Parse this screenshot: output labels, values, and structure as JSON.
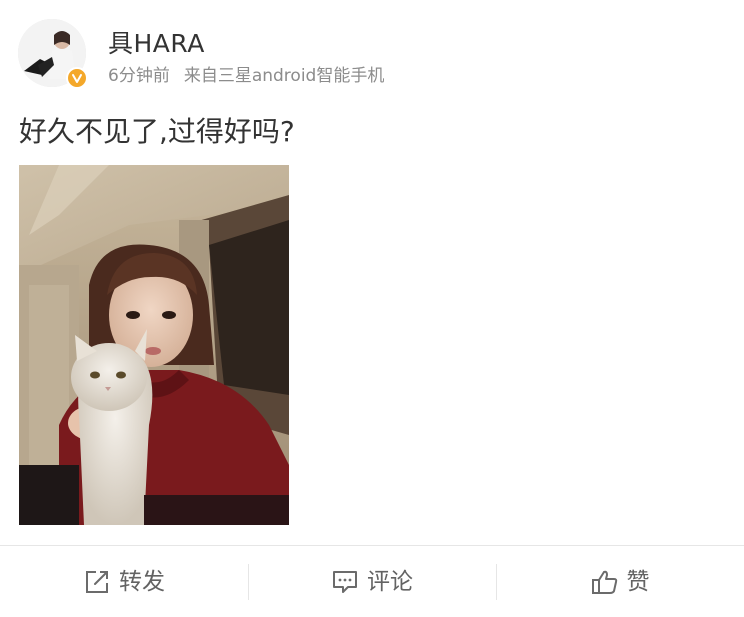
{
  "post": {
    "username": "具HARA",
    "time": "6分钟前",
    "source": "来自三星android智能手机",
    "text": "好久不见了,过得好吗?",
    "verified_color": "#f4a82a"
  },
  "actions": {
    "repost_label": "转发",
    "comment_label": "评论",
    "like_label": "赞"
  },
  "icons": {
    "repost": "share-arrow-icon",
    "comment": "speech-bubble-icon",
    "like": "thumbs-up-icon",
    "verified": "verified-check-icon"
  }
}
